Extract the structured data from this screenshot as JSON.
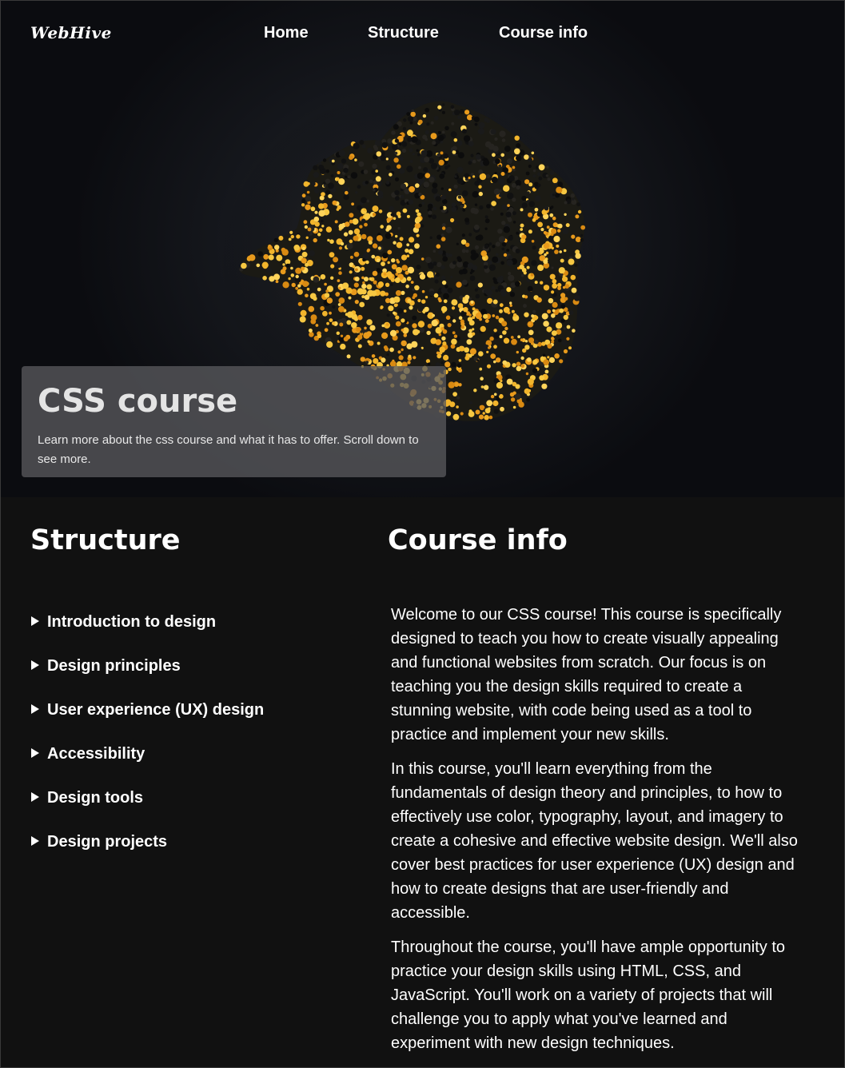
{
  "nav": {
    "logo": "WebHive",
    "links": [
      "Home",
      "Structure",
      "Course info"
    ]
  },
  "hero": {
    "title": "CSS course",
    "subtitle": "Learn more about the css course and what it has to offer. Scroll down to see more."
  },
  "structure": {
    "title": "Structure",
    "items": [
      "Introduction to design",
      "Design principles",
      "User experience (UX) design",
      "Accessibility",
      "Design tools",
      "Design projects"
    ]
  },
  "course_info": {
    "title": "Course info",
    "paragraphs": [
      "Welcome to our CSS course! This course is specifically designed to teach you how to create visually appealing and functional websites from scratch. Our focus is on teaching you the design skills required to create a stunning website, with code being used as a tool to practice and implement your new skills.",
      "In this course, you'll learn everything from the fundamentals of design theory and principles, to how to effectively use color, typography, layout, and imagery to create a cohesive and effective website design. We'll also cover best practices for user experience (UX) design and how to create designs that are user-friendly and accessible.",
      "Throughout the course, you'll have ample opportunity to practice your design skills using HTML, CSS, and JavaScript. You'll work on a variety of projects that will challenge you to apply what you've learned and experiment with new design techniques."
    ]
  },
  "colors": {
    "background": "#111111",
    "hero_card": "#58585c",
    "accent_gold": "#f2b52c",
    "text": "#ffffff"
  }
}
